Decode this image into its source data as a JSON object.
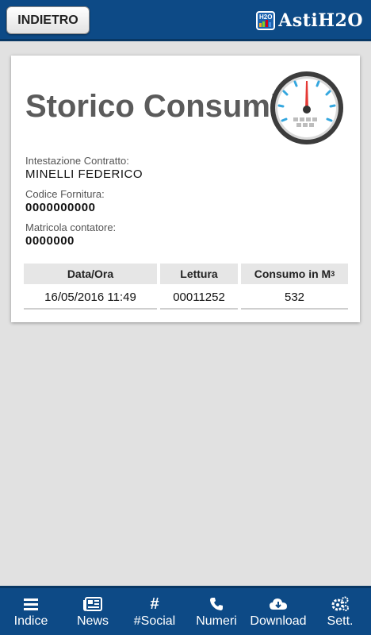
{
  "header": {
    "back_label": "INDIETRO",
    "logo_badge": "H2O",
    "logo_text": "AstiH2O"
  },
  "card": {
    "title": "Storico Consumi",
    "fields": [
      {
        "label": "Intestazione Contratto:",
        "value": "MINELLI FEDERICO"
      },
      {
        "label": "Codice Fornitura:",
        "value": "0000000000"
      },
      {
        "label": "Matricola contatore:",
        "value": "0000000"
      }
    ],
    "table": {
      "headers": [
        "Data/Ora",
        "Lettura",
        "Consumo in M",
        "3"
      ],
      "rows": [
        {
          "date": "16/05/2016 11:49",
          "reading": "00011252",
          "consumption": "532"
        }
      ]
    }
  },
  "bottom_nav": {
    "items": [
      {
        "label": "Indice",
        "icon": "menu-icon"
      },
      {
        "label": "News",
        "icon": "newspaper-icon"
      },
      {
        "label": "#Social",
        "icon": "hashtag-icon"
      },
      {
        "label": "Numeri",
        "icon": "phone-icon"
      },
      {
        "label": "Download",
        "icon": "cloud-download-icon"
      },
      {
        "label": "Sett.",
        "icon": "gears-icon"
      }
    ]
  },
  "colors": {
    "header_bg": "#0d4a86",
    "page_bg": "#e1e1e1",
    "gauge_ticks": "#35a7df",
    "gauge_needle": "#e53935"
  }
}
